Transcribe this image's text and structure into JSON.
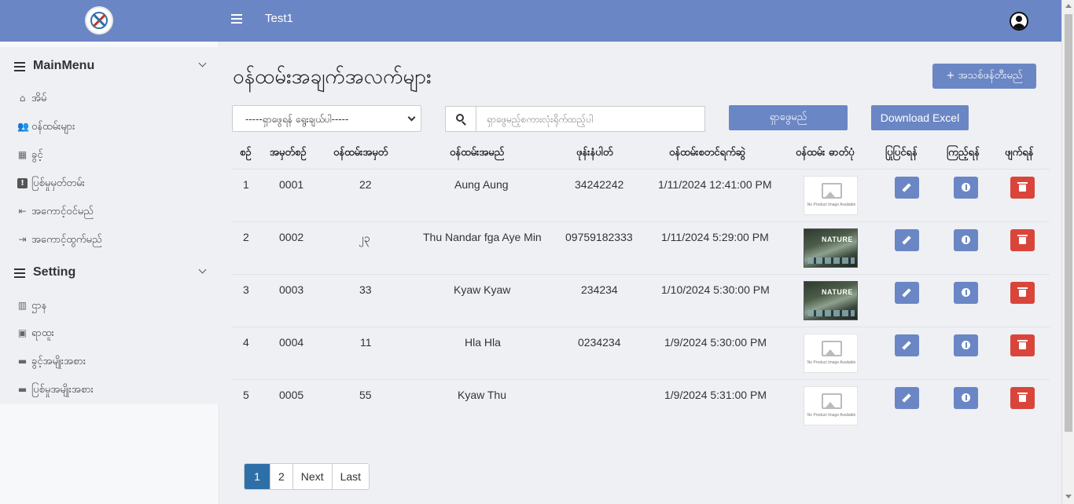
{
  "app": {
    "title": "Test1"
  },
  "sidebar": {
    "main_menu_label": "MainMenu",
    "main_items": [
      {
        "label": "အိမ်",
        "icon": "home-icon"
      },
      {
        "label": "ဝန်ထမ်းများ",
        "icon": "users-icon"
      },
      {
        "label": "ခွင့်",
        "icon": "calendar-icon"
      },
      {
        "label": "ပြစ်မှုမှတ်တမ်း",
        "icon": "alert-icon"
      },
      {
        "label": "အကောင့်ဝင်မည်",
        "icon": "login-icon"
      },
      {
        "label": "အကောင့်ထွက်မည်",
        "icon": "logout-icon"
      }
    ],
    "setting_label": "Setting",
    "setting_items": [
      {
        "label": "ဌာန",
        "icon": "building-icon"
      },
      {
        "label": "ရာထူး",
        "icon": "badge-icon"
      },
      {
        "label": "ခွင့်အမျိုးအစား",
        "icon": "archive-icon"
      },
      {
        "label": "ပြစ်မှုအမျိုးအစား",
        "icon": "archive-icon"
      }
    ]
  },
  "main": {
    "title": "ဝန်ထမ်းအချက်အလက်များ",
    "new_button": "+ အသစ်ဖန်တီးမည်",
    "filter_value": "-----ရှာဖွေရန် ရွေးချယ်ပါ-----",
    "search_placeholder": "ရှာဖွေမည့်စကားလုံးရိုက်ထည့်ပါ",
    "search_button": "ရှာဖွေမည်",
    "excel_button": "Download Excel"
  },
  "table": {
    "headers": [
      "စဉ်",
      "အမှတ်စဉ်",
      "ဝန်ထမ်းအမှတ်",
      "ဝန်ထမ်းအမည်",
      "ဖုန်းနံပါတ်",
      "ဝန်ထမ်းစတင်ရက်ဆွဲ",
      "ဝန်ထမ်း ဓာတ်ပုံ",
      "ပြုပြင်ရန်",
      "ကြည့်ရန်",
      "ဖျက်ရန်"
    ],
    "rows": [
      {
        "no": "1",
        "code": "0001",
        "emp_no": "22",
        "name": "Aung Aung",
        "phone": "34242242",
        "start": "1/11/2024 12:41:00 PM",
        "photo": "no-image"
      },
      {
        "no": "2",
        "code": "0002",
        "emp_no": "၂၃",
        "name": "Thu Nandar fga Aye Min",
        "phone": "09759182333",
        "start": "1/11/2024 5:29:00 PM",
        "photo": "nature"
      },
      {
        "no": "3",
        "code": "0003",
        "emp_no": "33",
        "name": "Kyaw Kyaw",
        "phone": "234234",
        "start": "1/10/2024 5:30:00 PM",
        "photo": "nature"
      },
      {
        "no": "4",
        "code": "0004",
        "emp_no": "11",
        "name": "Hla Hla",
        "phone": "0234234",
        "start": "1/9/2024 5:30:00 PM",
        "photo": "no-image"
      },
      {
        "no": "5",
        "code": "0005",
        "emp_no": "55",
        "name": "Kyaw Thu",
        "phone": "",
        "start": "1/9/2024 5:31:00 PM",
        "photo": "no-image"
      }
    ],
    "no_image_caption": "No Product Image Available",
    "nature_caption": "NATURE"
  },
  "pagination": {
    "pages": [
      "1",
      "2"
    ],
    "next": "Next",
    "last": "Last",
    "current": "1"
  },
  "colors": {
    "primary": "#6b86c4",
    "danger": "#d9453a",
    "active_page": "#2f6fa8"
  }
}
